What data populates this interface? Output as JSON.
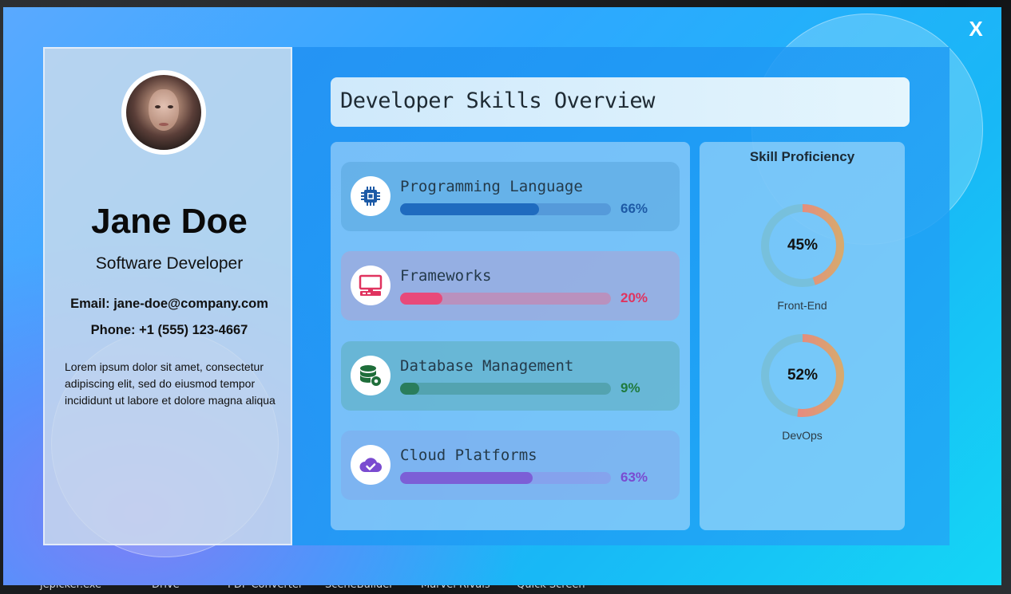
{
  "window": {
    "close_label": "X"
  },
  "taskbar": {
    "items": [
      "jepicker.exe",
      "Drive",
      "PDF Converter",
      "SceneBuilder",
      "Marvel Rivals",
      "Quick Screen"
    ]
  },
  "profile": {
    "name": "Jane Doe",
    "role": "Software Developer",
    "email": "Email: jane-doe@company.com",
    "phone": "Phone: +1 (555) 123-4667",
    "bio": "Lorem ipsum dolor sit amet, consectetur adipiscing elit, sed do eiusmod tempor incididunt ut labore et dolore magna aliqua"
  },
  "header": {
    "title": "Developer Skills Overview"
  },
  "skills": [
    {
      "label": "Programming Language",
      "percent_text": "66%",
      "value": 0.66,
      "icon": "cpu-chip-icon",
      "color": "#1f6bbf"
    },
    {
      "label": "Frameworks",
      "percent_text": "20%",
      "value": 0.2,
      "icon": "desktop-computer-icon",
      "color": "#e84a7a"
    },
    {
      "label": "Database Management",
      "percent_text": "9%",
      "value": 0.09,
      "icon": "database-gear-icon",
      "color": "#2a7d5c"
    },
    {
      "label": "Cloud Platforms",
      "percent_text": "63%",
      "value": 0.63,
      "icon": "cloud-check-icon",
      "color": "#7c5fd6"
    }
  ],
  "proficiency": {
    "title": "Skill Proficiency",
    "items": [
      {
        "label": "Front-End",
        "percent_text": "45%",
        "value": 0.45
      },
      {
        "label": "DevOps",
        "percent_text": "52%",
        "value": 0.52
      }
    ]
  }
}
